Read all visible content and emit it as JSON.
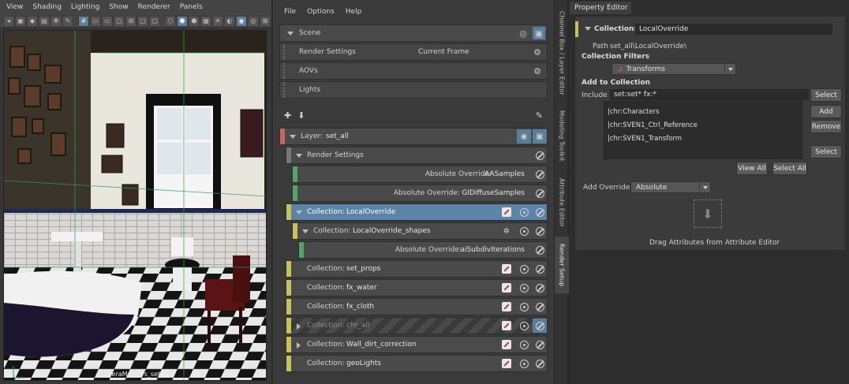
{
  "viewport": {
    "menu": [
      "View",
      "Shading",
      "Lighting",
      "Show",
      "Renderer",
      "Panels"
    ],
    "camera_label": "cameraMain (rs_set_all)"
  },
  "render_setup": {
    "menu": [
      "File",
      "Options",
      "Help"
    ],
    "scene_rows": [
      {
        "label": "Scene",
        "kind": "header"
      },
      {
        "label": "Render Settings",
        "middle": "Current Frame"
      },
      {
        "label": "AOVs"
      },
      {
        "label": "Lights"
      }
    ],
    "layer": {
      "prefix": "Layer:",
      "name": "set_all"
    },
    "rows": [
      {
        "kind": "group",
        "label": "Render Settings",
        "value": ""
      },
      {
        "kind": "override",
        "label": "Absolute Override:",
        "value": "AASamples"
      },
      {
        "kind": "override",
        "label": "Absolute Override:",
        "value": "GIDiffuseSamples"
      },
      {
        "kind": "collection",
        "label": "Collection:",
        "value": "LocalOverride",
        "selected": true
      },
      {
        "kind": "subcollection",
        "label": "Collection:",
        "value": "LocalOverride_shapes"
      },
      {
        "kind": "subover",
        "label": "Absolute Override:",
        "value": "aiSubdivIterations"
      },
      {
        "kind": "collection",
        "label": "Collection:",
        "value": "set_props"
      },
      {
        "kind": "collection",
        "label": "Collection:",
        "value": "fx_water"
      },
      {
        "kind": "collection",
        "label": "Collection:",
        "value": "fx_cloth"
      },
      {
        "kind": "collection",
        "label": "Collection:",
        "value": "chr_all",
        "disabled": true
      },
      {
        "kind": "collection",
        "label": "Collection:",
        "value": "Wall_dirt_correction"
      },
      {
        "kind": "collection",
        "label": "Collection:",
        "value": "geoLights"
      }
    ]
  },
  "side_tabs": [
    "Channel Box / Layer Editor",
    "Modeling Toolkit",
    "Attribute Editor",
    "Render Setup"
  ],
  "property_editor": {
    "tab": "Property Editor",
    "collection_label": "Collection:",
    "collection_name": "LocalOverride",
    "path_label": "Path",
    "path_value": "set_all\\LocalOverride\\",
    "filters_label": "Collection Filters",
    "filter_value": "Transforms",
    "add_to_label": "Add to Collection",
    "include_label": "Include",
    "include_value": "set:set* fx:*",
    "list_items": [
      "|chr:Characters",
      "|chr:SVEN1_Ctrl_Reference",
      "|chr:SVEN1_Transform"
    ],
    "buttons": {
      "select": "Select",
      "add": "Add",
      "remove": "Remove",
      "select2": "Select",
      "view_all": "View All",
      "select_all": "Select All"
    },
    "add_override_label": "Add Override",
    "add_override_value": "Absolute",
    "drag_hint": "Drag Attributes from Attribute Editor"
  },
  "colors": {
    "layer_bar": "#c86464",
    "render_settings_bar": "#787878",
    "override_bar": "#55a26a",
    "collection_bar": "#c9c25a",
    "selected": "#5c84a8"
  }
}
